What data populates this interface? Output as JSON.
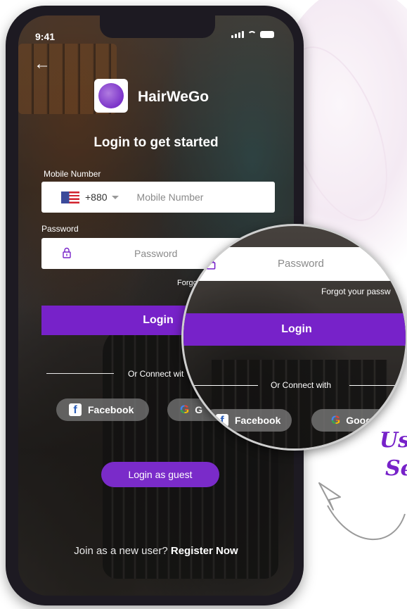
{
  "status_bar": {
    "time": "9:41"
  },
  "brand": {
    "name": "HairWeGo"
  },
  "heading": "Login to get started",
  "mobile": {
    "label": "Mobile Number",
    "country_code": "+880",
    "placeholder": "Mobile Number"
  },
  "password": {
    "label": "Password",
    "placeholder": "Password"
  },
  "forgot_clipped": "Forgot",
  "login_label": "Login",
  "divider_text_clipped": "Or Connect wit",
  "social": {
    "facebook": "Facebook",
    "google_clipped": "G"
  },
  "guest_label": "Login as guest",
  "register": {
    "prompt": "Join as a new user?",
    "action": "Register Now"
  },
  "zoom": {
    "password_placeholder": "Password",
    "forgot": "Forgot your passw",
    "login": "Login",
    "divider_text": "Or Connect with",
    "facebook": "Facebook",
    "google": "Goog"
  },
  "annotation": {
    "line1": "Us",
    "line2": "Se"
  },
  "colors": {
    "accent": "#7722c9",
    "google": "#4285f4",
    "facebook": "#2d5fb8"
  }
}
